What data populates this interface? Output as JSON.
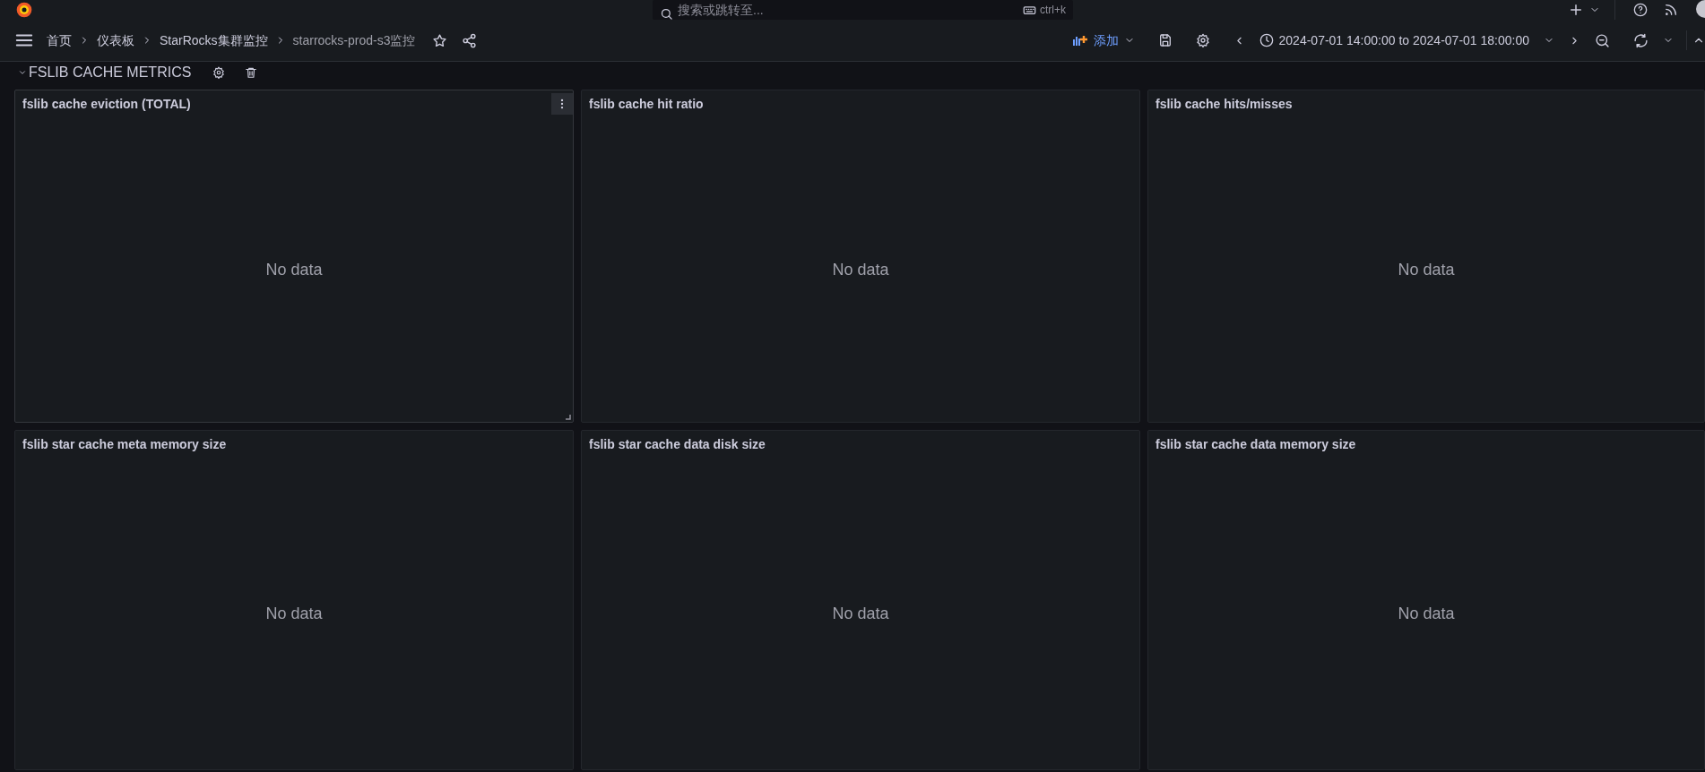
{
  "topbar": {
    "search": {
      "placeholder": "搜索或跳转至..."
    },
    "shortcut": "ctrl+k"
  },
  "breadcrumbs": [
    {
      "label": "首页",
      "current": false
    },
    {
      "label": "仪表板",
      "current": false
    },
    {
      "label": "StarRocks集群监控",
      "current": false
    },
    {
      "label": "starrocks-prod-s3监控",
      "current": true
    }
  ],
  "toolbar": {
    "add_label": "添加",
    "time_range": "2024-07-01 14:00:00 to 2024-07-01 18:00:00"
  },
  "row": {
    "title": "FSLIB CACHE METRICS",
    "expanded": true
  },
  "panels": [
    {
      "title": "fslib cache eviction (TOTAL)",
      "message": "No data",
      "hovered": true
    },
    {
      "title": "fslib cache hit ratio",
      "message": "No data",
      "hovered": false
    },
    {
      "title": "fslib cache hits/misses",
      "message": "No data",
      "hovered": false
    },
    {
      "title": "fslib star cache meta memory size",
      "message": "No data",
      "hovered": false
    },
    {
      "title": "fslib star cache data disk size",
      "message": "No data",
      "hovered": false
    },
    {
      "title": "fslib star cache data memory size",
      "message": "No data",
      "hovered": false
    }
  ]
}
